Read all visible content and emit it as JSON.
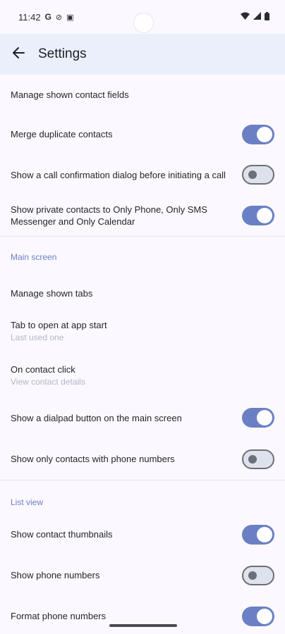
{
  "status_bar": {
    "time": "11:42",
    "left_icons": [
      "google-icon",
      "dnd-icon",
      "notification-icon"
    ],
    "right_icons": [
      "wifi-icon",
      "signal-icon",
      "battery-icon"
    ]
  },
  "app_bar": {
    "title": "Settings"
  },
  "rows_top": [
    {
      "label": "Manage shown contact fields"
    },
    {
      "label": "Merge duplicate contacts",
      "toggle": true
    },
    {
      "label": "Show a call confirmation dialog before initiating a call",
      "toggle": false
    },
    {
      "label": "Show private contacts to Only Phone, Only SMS Messenger and Only Calendar",
      "toggle": true
    }
  ],
  "main_screen": {
    "header": "Main screen",
    "manage_tabs": {
      "label": "Manage shown tabs"
    },
    "tab_to_open": {
      "label": "Tab to open at app start",
      "value": "Last used one"
    },
    "contact_click": {
      "label": "On contact click",
      "value": "View contact details"
    },
    "dialpad_button": {
      "label": "Show a dialpad button on the main screen",
      "toggle": true
    },
    "only_phone_numbers": {
      "label": "Show only contacts with phone numbers",
      "toggle": false
    }
  },
  "list_view": {
    "header": "List view",
    "thumbnails": {
      "label": "Show contact thumbnails",
      "toggle": true
    },
    "phone_numbers": {
      "label": "Show phone numbers",
      "toggle": false
    },
    "format_numbers": {
      "label": "Format phone numbers",
      "toggle": true
    }
  },
  "colors": {
    "accent": "#6b7fc4",
    "app_bar_bg": "#eaeffb",
    "background": "#fbf9ff"
  }
}
